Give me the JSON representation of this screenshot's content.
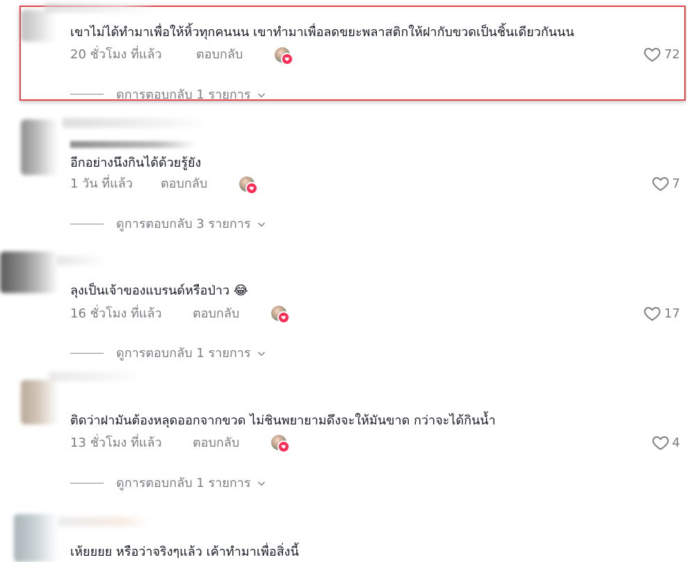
{
  "comments": [
    {
      "text": "เขาไม่ได้ทำมาเพื่อให้หิ้วทุกคนนน เขาทำมาเพื่อลดขยะพลาสติกให้ฝากับขวดเป็นชิ้นเดียวกันนน",
      "time": "20 ชั่วโมง ที่แล้ว",
      "reply": "ตอบกลับ",
      "likes": "72",
      "view_replies": "ดูการตอบกลับ 1 รายการ"
    },
    {
      "text": "อีกอย่างนึงกินได้ด้วยรู้ยัง",
      "time": "1 วัน ที่แล้ว",
      "reply": "ตอบกลับ",
      "likes": "7",
      "view_replies": "ดูการตอบกลับ 3 รายการ"
    },
    {
      "text": "ลุงเป็นเจ้าของแบรนด์หรือป่าว 😂",
      "time": "16 ชั่วโมง ที่แล้ว",
      "reply": "ตอบกลับ",
      "likes": "17",
      "view_replies": "ดูการตอบกลับ 1 รายการ"
    },
    {
      "text": "ติดว่าฝามันต้องหลุดออกจากขวด ไม่ชินพยายามดึงจะให้มันขาด กว่าจะได้กินน้ำ",
      "time": "13 ชั่วโมง ที่แล้ว",
      "reply": "ตอบกลับ",
      "likes": "4",
      "view_replies": "ดูการตอบกลับ 1 รายการ"
    },
    {
      "text": "เห้ยยยย หรือว่าจริงๆแล้ว เค้าทำมาเพื่อสิ่งนี้"
    }
  ],
  "colors": {
    "accent": "#fe2c55",
    "highlight_border": "#e0474c",
    "secondary_text": "#7b7c82"
  },
  "icons": {
    "like": "heart-outline-icon",
    "creator_liked": "creator-avatar-heart-badge",
    "expand": "chevron-down-icon"
  }
}
